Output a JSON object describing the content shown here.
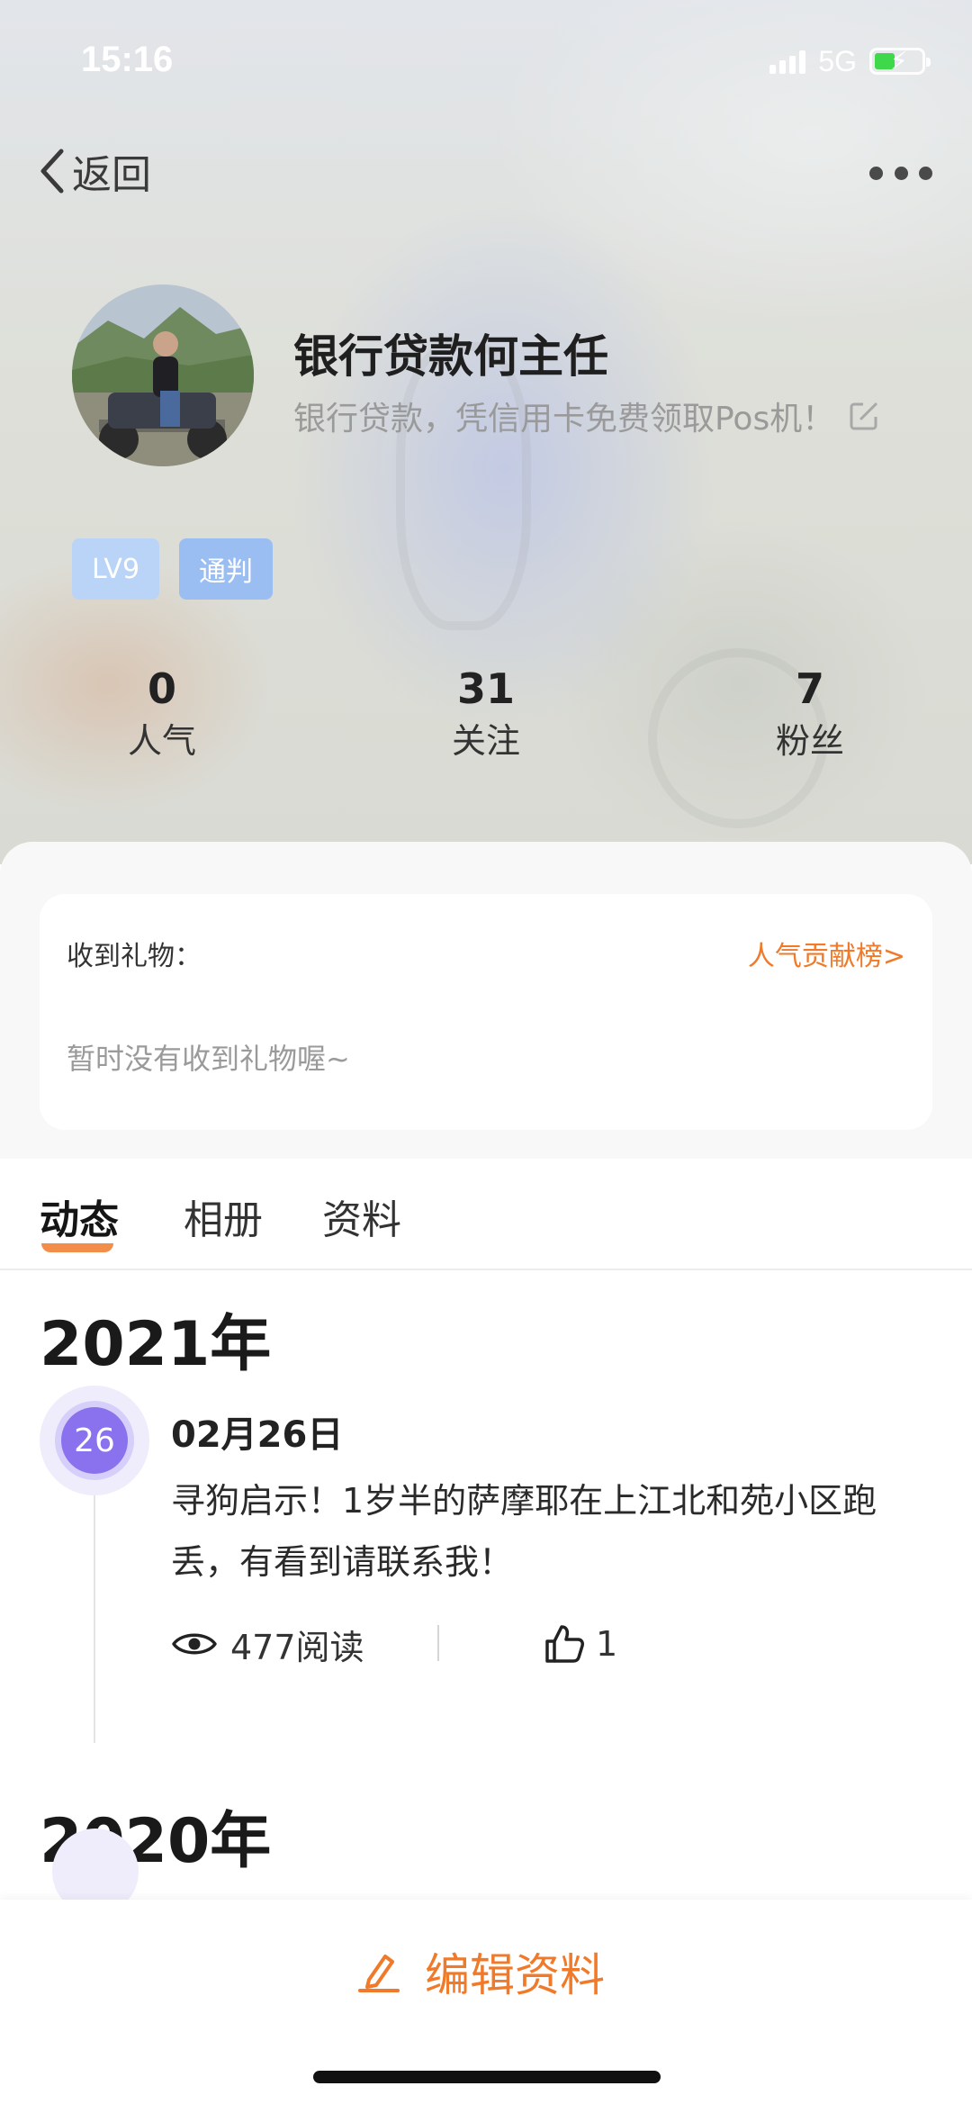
{
  "status_bar": {
    "time": "15:16",
    "network": "5G",
    "battery_level": 0.35,
    "battery_charging": true,
    "signal_bars": 4
  },
  "nav": {
    "back_label": "返回"
  },
  "profile": {
    "name": "银行贷款何主任",
    "bio": "银行贷款，凭信用卡免费领取Pos机！",
    "badges": {
      "level": "LV9",
      "city": "通判"
    }
  },
  "stats": [
    {
      "value": "0",
      "label": "人气"
    },
    {
      "value": "31",
      "label": "关注"
    },
    {
      "value": "7",
      "label": "粉丝"
    }
  ],
  "gifts": {
    "title": "收到礼物：",
    "link": "人气贡献榜>",
    "empty": "暂时没有收到礼物喔~"
  },
  "tabs": [
    {
      "label": "动态",
      "active": true
    },
    {
      "label": "相册",
      "active": false
    },
    {
      "label": "资料",
      "active": false
    }
  ],
  "feed": {
    "years": [
      "2021年",
      "2020年"
    ],
    "posts": [
      {
        "day": "26",
        "date": "02月26日",
        "text": "寻狗启示！1岁半的萨摩耶在上江北和苑小区跑丢，有看到请联系我！",
        "views": "477阅读",
        "likes": "1"
      }
    ]
  },
  "bottom": {
    "edit_label": "编辑资料"
  },
  "colors": {
    "accent": "#f07a2a",
    "date_dot": "#8a72ee",
    "badge_level": "#b9d4f7",
    "badge_city": "#9bbef2"
  }
}
